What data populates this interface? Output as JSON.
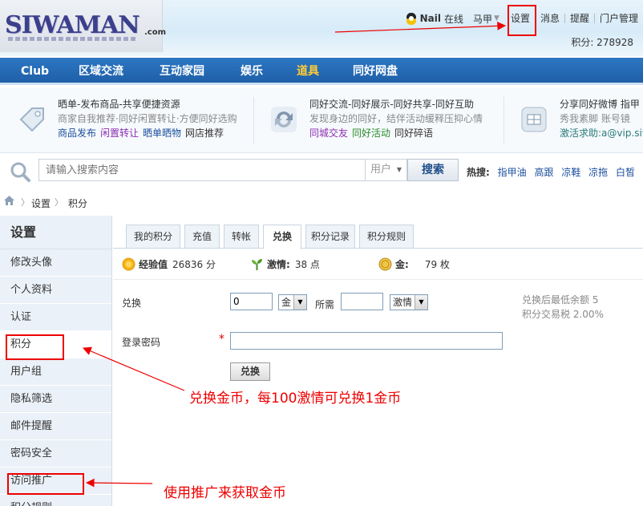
{
  "header": {
    "logo_text": "SIWAMAN",
    "logo_suffix": ".com",
    "user_name": "Nail",
    "online_label": "在线",
    "second_name": "马甲",
    "links": [
      "设置",
      "消息",
      "提醒",
      "门户管理"
    ],
    "score_label": "积分: 278928"
  },
  "nav": {
    "items": [
      "Club",
      "区域交流",
      "互动家园",
      "娱乐",
      "道具",
      "同好网盘"
    ],
    "active_index": 4
  },
  "promo": [
    {
      "icon": "tag-icon",
      "line1": "晒单-发布商品-共享便捷资源",
      "line2": "商家自我推荐·同好闲置转让·方便同好选购",
      "links": [
        "商品发布",
        "闲置转让",
        "晒单晒物",
        "网店推荐"
      ]
    },
    {
      "icon": "refresh-icon",
      "line1": "同好交流-同好展示-同好共享-同好互助",
      "line2": "发现身边的同好，结伴活动缓释压抑心情",
      "links": [
        "同城交友",
        "同好活动",
        "同好碎语"
      ]
    },
    {
      "icon": "weibo-icon",
      "line1": "分享同好微博  指甲",
      "line2": "秀我素脚  账号镜",
      "line3": "激活求助:a@vip.siw"
    }
  ],
  "search": {
    "placeholder": "请输入搜索内容",
    "type_label": "用户",
    "button_label": "搜索",
    "hot_label": "热搜:",
    "hot_keywords": [
      "指甲油",
      "高跟",
      "凉鞋",
      "凉拖",
      "白皙"
    ]
  },
  "breadcrumb": [
    "设置",
    "积分"
  ],
  "sidebar": {
    "title": "设置",
    "items": [
      "修改头像",
      "个人资料",
      "认证",
      "积分",
      "用户组",
      "隐私筛选",
      "邮件提醒",
      "密码安全",
      "访问推广",
      "积分规则"
    ]
  },
  "tabs": [
    "我的积分",
    "充值",
    "转帐",
    "兑换",
    "积分记录",
    "积分规则"
  ],
  "active_tab": "兑换",
  "stats": [
    {
      "icon": "sun-icon",
      "label": "经验值",
      "value": "26836 分"
    },
    {
      "icon": "sprout-icon",
      "label": "激情:",
      "value": "38 点"
    },
    {
      "icon": "coin-icon",
      "label": "金:",
      "value": "79 枚"
    }
  ],
  "form": {
    "exchange_label": "兑换",
    "amount_value": "0",
    "from_unit": "金",
    "need_label": "所需",
    "need_value": "",
    "to_unit": "激情",
    "password_label": "登录密码",
    "required_mark": "*",
    "password_value": "",
    "submit_label": "兑换",
    "info_line1": "兑换后最低余额 5",
    "info_line2": "积分交易税 2.00%"
  },
  "annotations": {
    "text1": "兑换金币，每100激情可兑换1金币",
    "text2": "使用推广来获取金币"
  },
  "colors": {
    "nav_bg": "#2c77c3",
    "nav_active": "#ffcc33",
    "sidebar_bg": "#eaf1f8",
    "annotation_red": "#e00000"
  }
}
